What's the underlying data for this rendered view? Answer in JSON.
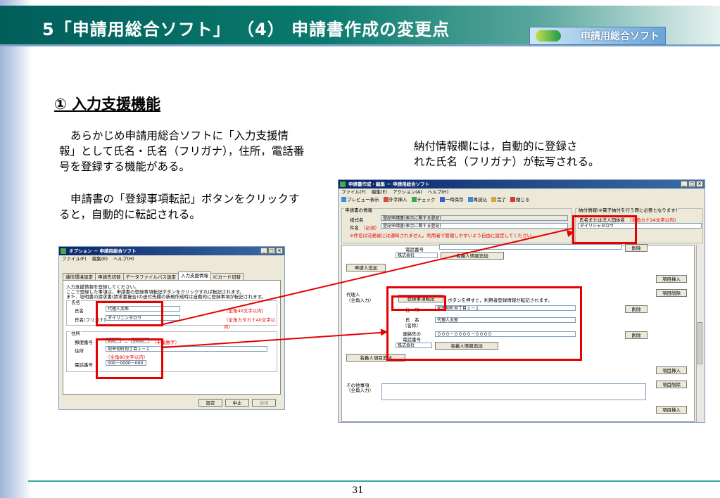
{
  "slide": {
    "title": "5「申請用総合ソフト」 （4） 申請書作成の変更点",
    "logo_text": "申請用総合ソフト",
    "section_title": "①  入力支援機能",
    "para1_line1": "あらかじめ申請用総合ソフトに「入力支援情",
    "para1_line2": "報」として氏名・氏名（フリガナ），住所，電話番",
    "para1_line3": "号を登録する機能がある。",
    "para2_line1": "申請書の「登録事項転記」ボタンをクリックす",
    "para2_line2": "ると，自動的に転記される。",
    "para3_line1": "納付情報欄には，自動的に登録さ",
    "para3_line2": "れた氏名（フリガナ）が転写される。",
    "page_number": "31"
  },
  "options_window": {
    "title": "オプション － 申請用総合ソフト",
    "menu": [
      "ファイル(F)",
      "編集(E)",
      "ヘルプ(H)"
    ],
    "tabs": [
      "通信環境設定",
      "申請先切替",
      "データファイルパス設定",
      "入力支援情報",
      "ICカード切替"
    ],
    "active_tab": "入力支援情報",
    "desc1": "入力支援情報を登録してください。",
    "desc2": "ここで登録した事項は，申請書の登録事項転記ボタンをクリックすれば転記されます。",
    "desc3": "また，証明書の請求書(請求書複合)の送付先欄の新規作成時は自動的に登録事項が転記されます。",
    "group_name": "氏名",
    "name_label": "氏名",
    "name_value": "代理人太郎",
    "name_hint": "（全角40文字以内）",
    "kana_label": "氏名(フリガナ)",
    "kana_value": "ダイリニンタロウ",
    "kana_hint": "（全角カタカナ40文字以内）",
    "group_address": "住所",
    "zip_label": "郵便番号",
    "zip1": "000",
    "zip_sep": "－",
    "zip2": "0000",
    "zip_hint": "（半角数字）",
    "addr_label": "住所",
    "addr_value": "何市何町何丁目１－１",
    "addr_hint": "（全角80文字以内）",
    "tel_label": "電話番号",
    "tel_value": "000－0000－000",
    "btn_ok": "設定",
    "btn_cancel": "中止",
    "btn_apply": "適用"
  },
  "edit_window": {
    "title": "申請書作成・編集 － 申請用総合ソフト",
    "menu": [
      "ファイル(F)",
      "編集(E)",
      "アクション(A)",
      "ヘルプ(H)"
    ],
    "toolbar": [
      "プレビュー表示",
      "外字挿入",
      "チェック",
      "一時保存",
      "再読込",
      "完了",
      "閉じる"
    ],
    "info_group": "申請書の情報",
    "form_label": "様式名",
    "form_value": "登記申請書(表示に関する登記)",
    "subject_label": "件名",
    "subject_required": "（必須）",
    "subject_value": "登記申請書(表示に関する登記)",
    "info_note": "※件名は法務省には通知されません。利用者で管理しやすいよう自由に設定してください。",
    "pay_group": "納付情報(※電子納付を行う際に必要となります)",
    "pay_label": "氏名または法人団体名",
    "pay_hint": "(全角カナ24文字以内)",
    "pay_value": "ダイリシャタロウ",
    "tel_label_top": "電話番号",
    "company": "株式会社",
    "btn_add_name_info": "名義人情報追加",
    "btn_delete": "削除",
    "btn_add_applicant": "申請人追加",
    "btn_insert_item": "項目挿入",
    "btn_delete_item": "項目削除",
    "agent_label": "代理人",
    "agent_sub": "（全角入力）",
    "btn_transfer": "登録事項転記",
    "transfer_note": "ボタンを押すと，利用者登録情報が転記されます。",
    "addr_label": "住　所",
    "addr_value": "何市何町何丁目１－１",
    "name_label": "氏　名",
    "name_sub": "（名称）",
    "name_value": "代理人太郎",
    "contact_label": "連絡先の",
    "contact_sub": "電話番号",
    "contact_value": "０００－００００－００００",
    "btn_add_name_item": "名義人項目追加",
    "other_label": "その他事項",
    "other_sub": "（全角入力）"
  },
  "colors": {
    "header_green": "#005e5a",
    "highlight_red": "#e60000",
    "titlebar_blue": "#0a246a"
  }
}
